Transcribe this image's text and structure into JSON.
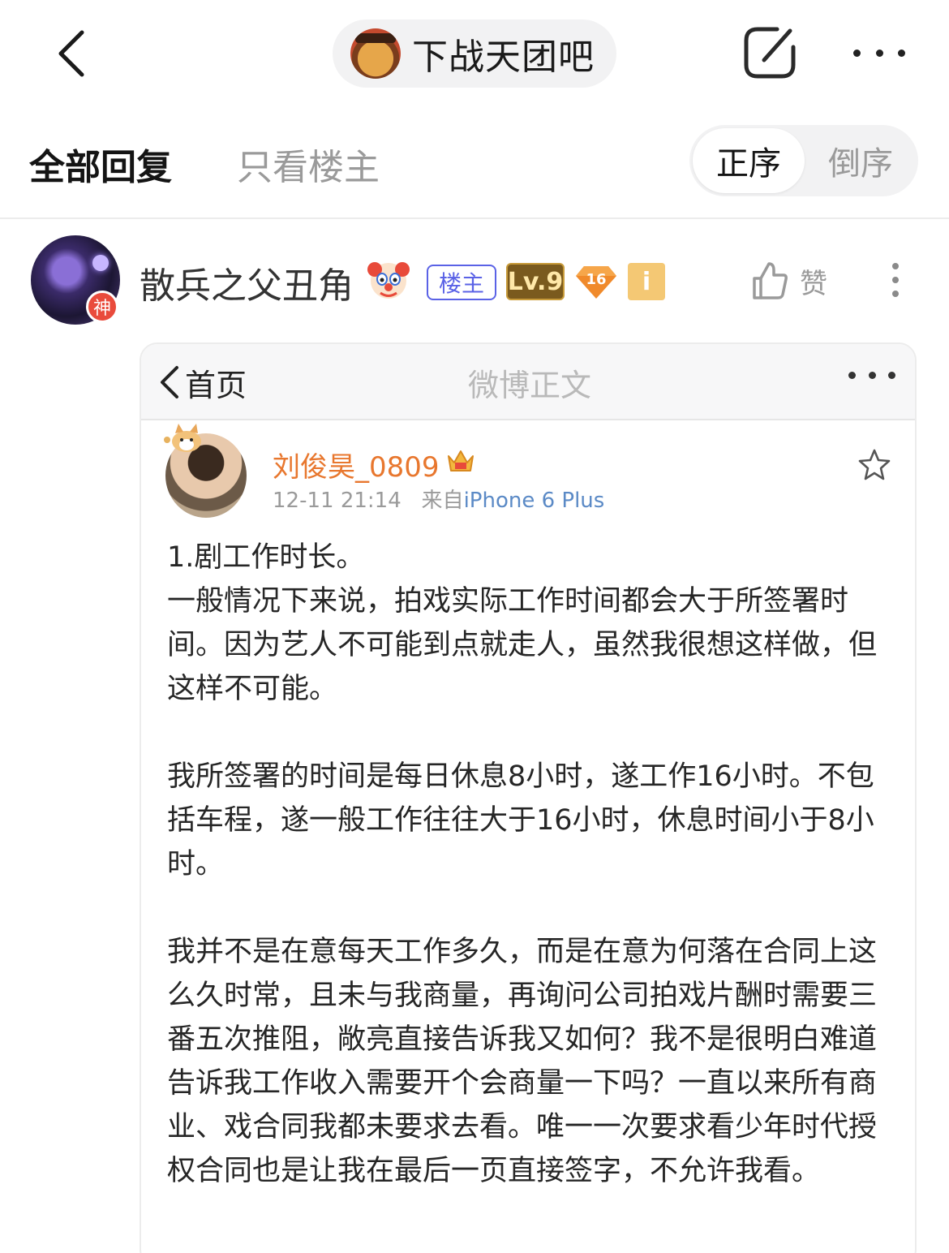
{
  "header": {
    "forum_name": "下战天团吧"
  },
  "tabs": {
    "all_replies": "全部回复",
    "host_only": "只看楼主",
    "order_asc": "正序",
    "order_desc": "倒序"
  },
  "post": {
    "author": "散兵之父丑角",
    "avatar_badge": "神",
    "host_tag": "楼主",
    "level": "Lv.9",
    "vip_level": "16",
    "info_tag": "i",
    "like_label": "赞"
  },
  "weibo": {
    "nav_back": "首页",
    "nav_title": "微博正文",
    "username": "刘俊昊_0809",
    "time": "12-11 21:14",
    "source_prefix": "来自",
    "source": "iPhone 6 Plus",
    "paragraphs": [
      "1.剧工作时长。",
      "一般情况下来说，拍戏实际工作时间都会大于所签署时间。因为艺人不可能到点就走人，虽然我很想这样做，但这样不可能。",
      "",
      "我所签署的时间是每日休息8小时，遂工作16小时。不包括车程，遂一般工作往往大于16小时，休息时间小于8小时。",
      "",
      "我并不是在意每天工作多久，而是在意为何落在合同上这么久时常，且未与我商量，再询问公司拍戏片酬时需要三番五次推阻，敞亮直接告诉我又如何？我不是很明白难道告诉我工作收入需要开个会商量一下吗？一直以来所有商业、戏合同我都未要求去看。唯一一次要求看少年时代授权合同也是让我在最后一页直接签字，不允许我看。"
    ]
  },
  "colors": {
    "accent_orange": "#e8772e",
    "host_tag_blue": "#5a62e6",
    "link_blue": "#5b8ac6",
    "god_badge_red": "#e94b3c"
  },
  "icons": {
    "back": "chevron-left-icon",
    "edit": "edit-icon",
    "more": "more-horizontal-icon",
    "like": "thumbs-up-icon",
    "post_more": "more-vertical-icon",
    "star": "star-icon",
    "clown": "clown-emoji-icon",
    "crown": "crown-icon"
  }
}
